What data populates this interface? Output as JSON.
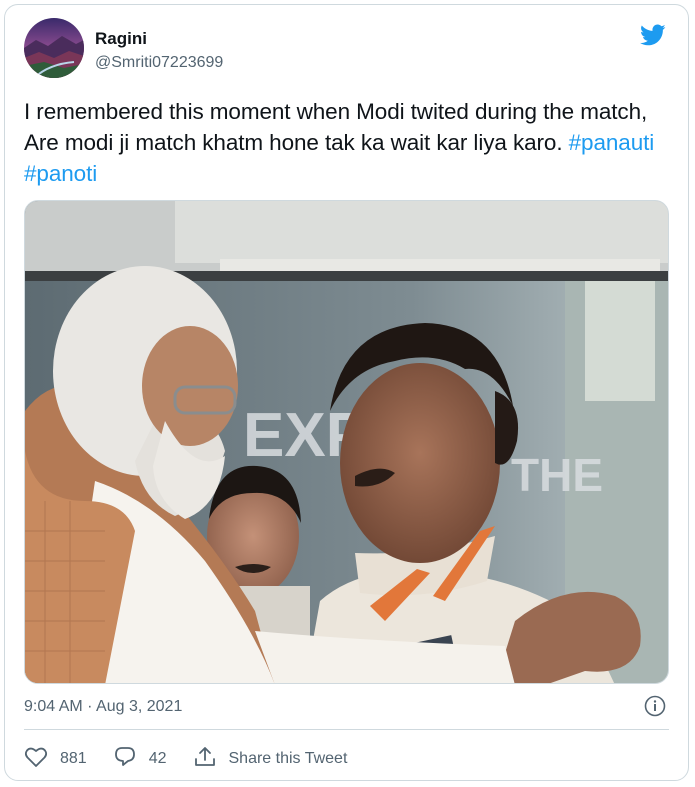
{
  "tweet": {
    "author": {
      "name": "Ragini",
      "handle": "@Smriti07223699",
      "avatar_icon": "avatar-landscape"
    },
    "platform_icon": "twitter-bird-icon",
    "brand_color": "#1d9bf0",
    "text_plain": "I remembered this moment when Modi twited during the match, Are modi ji match khatm hone tak ka wait kar liya karo.",
    "hashtags": [
      "#panauti",
      "#panoti"
    ],
    "media": {
      "sign_text": "EXP",
      "sign_text_2": "THE"
    },
    "timestamp": "9:04 AM · Aug 3, 2021",
    "actions": {
      "like_count": "881",
      "reply_count": "42",
      "share_label": "Share this Tweet"
    }
  }
}
